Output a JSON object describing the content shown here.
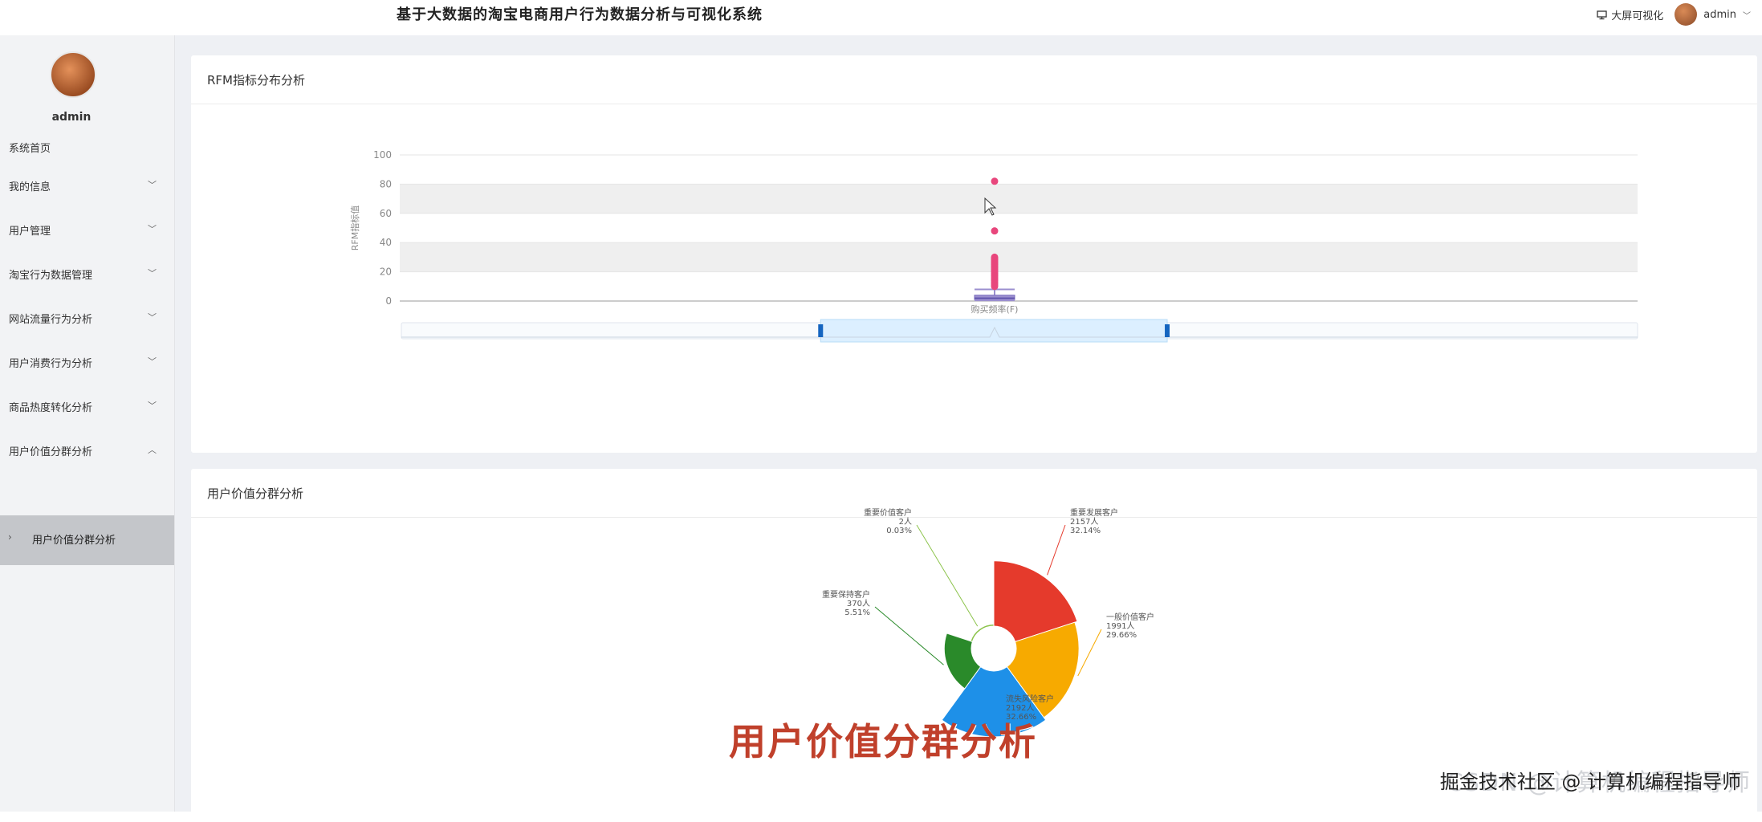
{
  "header": {
    "title": "基于大数据的淘宝电商用户行为数据分析与可视化系统",
    "bigscreen_label": "大屏可视化",
    "username": "admin"
  },
  "sidebar": {
    "username": "admin",
    "items": [
      {
        "label": "系统首页"
      },
      {
        "label": "我的信息"
      },
      {
        "label": "用户管理"
      },
      {
        "label": "淘宝行为数据管理"
      },
      {
        "label": "网站流量行为分析"
      },
      {
        "label": "用户消费行为分析"
      },
      {
        "label": "商品热度转化分析"
      },
      {
        "label": "用户价值分群分析"
      }
    ],
    "subitem": {
      "label": "用户价值分群分析"
    }
  },
  "rfm_card": {
    "title": "RFM指标分布分析"
  },
  "segment_card": {
    "title": "用户价值分群分析"
  },
  "overlay": {
    "caption": "用户价值分群分析",
    "watermark_csdn": "CSDN @计算机编程指导师",
    "watermark_juejin": "掘金技术社区 @ 计算机编程指导师"
  },
  "chart_data": [
    {
      "type": "boxplot",
      "title": "",
      "ylabel": "RFM指标值",
      "ylim": [
        0,
        100
      ],
      "yticks": [
        0,
        20,
        40,
        60,
        80,
        100
      ],
      "categories": [
        "购买频率(F)"
      ],
      "box": {
        "min": 0.5,
        "q1": 1.0,
        "median": 2.0,
        "q3": 4.0,
        "max": 8.0
      },
      "outliers": [
        82,
        48,
        30,
        29,
        28,
        27,
        26,
        25,
        24,
        23,
        22,
        21,
        20,
        19,
        18,
        17,
        16,
        15,
        14,
        13,
        12,
        11,
        10
      ],
      "colors": {
        "box": "#9b8fcf",
        "outlier": "#e8467c",
        "band": "#efefef"
      },
      "datazoom": {
        "start": 0.34,
        "end": 0.62
      }
    },
    {
      "type": "pie",
      "variant": "rose",
      "slices": [
        {
          "name": "重要发展客户",
          "count": "2157人",
          "pct": "32.14%",
          "color": "#e53a2c"
        },
        {
          "name": "一般价值客户",
          "count": "1991人",
          "pct": "29.66%",
          "color": "#f7aa00"
        },
        {
          "name": "流失风险客户",
          "count": "2192人",
          "pct": "32.66%",
          "color": "#1e90e8"
        },
        {
          "name": "重要保持客户",
          "count": "370人",
          "pct": "5.51%",
          "color": "#2a8a2a"
        },
        {
          "name": "重要价值客户",
          "count": "2人",
          "pct": "0.03%",
          "color": "#8bc34a"
        }
      ]
    }
  ]
}
